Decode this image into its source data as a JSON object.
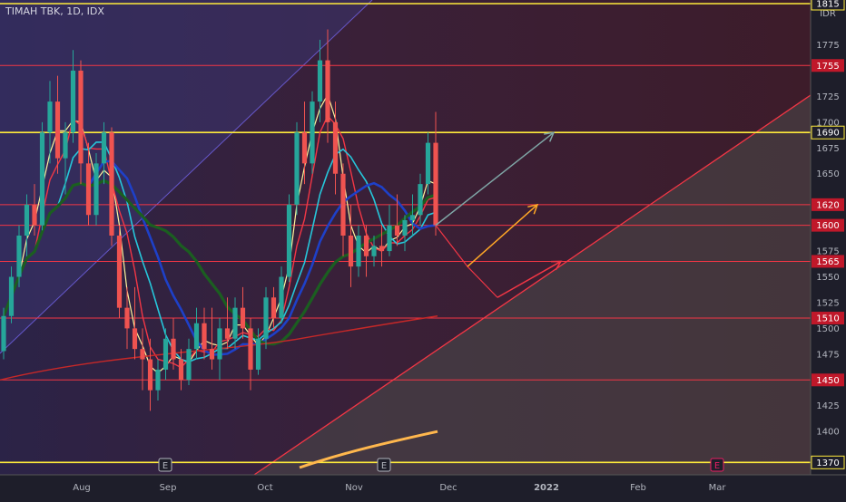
{
  "header": {
    "title": "TIMAH TBK, 1D, IDX"
  },
  "colors": {
    "bull": "#26a69a",
    "bear": "#ef5350",
    "yellow": "#ffeb3b",
    "red_line": "#f23645",
    "price_bg": "#2a1f2e"
  },
  "chart_data": {
    "type": "candlestick",
    "currency": "IDR",
    "y_ticks": [
      1775,
      1750,
      1725,
      1700,
      1675,
      1650,
      1625,
      1600,
      1575,
      1550,
      1525,
      1500,
      1475,
      1450,
      1425,
      1400
    ],
    "y_range": [
      1365,
      1815
    ],
    "x_labels": [
      "Aug",
      "Sep",
      "Oct",
      "Nov",
      "Dec",
      "2022",
      "Feb",
      "Mar"
    ],
    "levels": [
      {
        "label": "1815",
        "value": 1815,
        "color": "#ffeb3b"
      },
      {
        "label": "1755",
        "value": 1755,
        "color": "#f23645"
      },
      {
        "label": "1690",
        "value": 1690,
        "color": "#ffeb3b"
      },
      {
        "label": "1620",
        "value": 1620,
        "color": "#f23645"
      },
      {
        "label": "1600",
        "value": 1600,
        "color": "#f23645"
      },
      {
        "label": "1565",
        "value": 1565,
        "color": "#f23645"
      },
      {
        "label": "1510",
        "value": 1510,
        "color": "#f23645"
      },
      {
        "label": "1450",
        "value": 1450,
        "color": "#f23645"
      },
      {
        "label": "1370",
        "value": 1370,
        "color": "#ffeb3b"
      }
    ],
    "event_markers": [
      {
        "label": "E",
        "near": "Aug-Sep",
        "color": "#b2b5be"
      },
      {
        "label": "E",
        "near": "Nov",
        "color": "#b2b5be"
      },
      {
        "label": "E",
        "near": "Mar",
        "color": "#e91e63"
      }
    ],
    "candles": [
      {
        "o": 1478,
        "h": 1520,
        "l": 1470,
        "c": 1512
      },
      {
        "o": 1512,
        "h": 1560,
        "l": 1505,
        "c": 1550
      },
      {
        "o": 1550,
        "h": 1600,
        "l": 1540,
        "c": 1590
      },
      {
        "o": 1590,
        "h": 1630,
        "l": 1570,
        "c": 1620
      },
      {
        "o": 1620,
        "h": 1640,
        "l": 1590,
        "c": 1600
      },
      {
        "o": 1600,
        "h": 1700,
        "l": 1595,
        "c": 1690
      },
      {
        "o": 1690,
        "h": 1740,
        "l": 1660,
        "c": 1720
      },
      {
        "o": 1720,
        "h": 1745,
        "l": 1650,
        "c": 1665
      },
      {
        "o": 1665,
        "h": 1700,
        "l": 1630,
        "c": 1690
      },
      {
        "o": 1690,
        "h": 1770,
        "l": 1680,
        "c": 1750
      },
      {
        "o": 1750,
        "h": 1760,
        "l": 1640,
        "c": 1660
      },
      {
        "o": 1660,
        "h": 1680,
        "l": 1600,
        "c": 1610
      },
      {
        "o": 1610,
        "h": 1670,
        "l": 1600,
        "c": 1660
      },
      {
        "o": 1660,
        "h": 1700,
        "l": 1640,
        "c": 1690
      },
      {
        "o": 1690,
        "h": 1695,
        "l": 1580,
        "c": 1590
      },
      {
        "o": 1590,
        "h": 1600,
        "l": 1510,
        "c": 1520
      },
      {
        "o": 1520,
        "h": 1540,
        "l": 1480,
        "c": 1500
      },
      {
        "o": 1500,
        "h": 1540,
        "l": 1470,
        "c": 1480
      },
      {
        "o": 1480,
        "h": 1500,
        "l": 1440,
        "c": 1470
      },
      {
        "o": 1470,
        "h": 1490,
        "l": 1420,
        "c": 1440
      },
      {
        "o": 1440,
        "h": 1470,
        "l": 1430,
        "c": 1460
      },
      {
        "o": 1460,
        "h": 1500,
        "l": 1450,
        "c": 1490
      },
      {
        "o": 1490,
        "h": 1510,
        "l": 1460,
        "c": 1470
      },
      {
        "o": 1470,
        "h": 1480,
        "l": 1440,
        "c": 1450
      },
      {
        "o": 1450,
        "h": 1490,
        "l": 1445,
        "c": 1480
      },
      {
        "o": 1480,
        "h": 1520,
        "l": 1470,
        "c": 1505
      },
      {
        "o": 1505,
        "h": 1520,
        "l": 1470,
        "c": 1480
      },
      {
        "o": 1480,
        "h": 1520,
        "l": 1460,
        "c": 1470
      },
      {
        "o": 1470,
        "h": 1510,
        "l": 1450,
        "c": 1500
      },
      {
        "o": 1500,
        "h": 1530,
        "l": 1480,
        "c": 1490
      },
      {
        "o": 1490,
        "h": 1530,
        "l": 1480,
        "c": 1520
      },
      {
        "o": 1520,
        "h": 1540,
        "l": 1490,
        "c": 1500
      },
      {
        "o": 1500,
        "h": 1510,
        "l": 1440,
        "c": 1460
      },
      {
        "o": 1460,
        "h": 1500,
        "l": 1455,
        "c": 1490
      },
      {
        "o": 1490,
        "h": 1540,
        "l": 1480,
        "c": 1530
      },
      {
        "o": 1530,
        "h": 1540,
        "l": 1500,
        "c": 1510
      },
      {
        "o": 1510,
        "h": 1560,
        "l": 1505,
        "c": 1550
      },
      {
        "o": 1550,
        "h": 1630,
        "l": 1545,
        "c": 1620
      },
      {
        "o": 1620,
        "h": 1700,
        "l": 1610,
        "c": 1690
      },
      {
        "o": 1690,
        "h": 1720,
        "l": 1640,
        "c": 1660
      },
      {
        "o": 1660,
        "h": 1730,
        "l": 1650,
        "c": 1720
      },
      {
        "o": 1720,
        "h": 1780,
        "l": 1700,
        "c": 1760
      },
      {
        "o": 1760,
        "h": 1790,
        "l": 1680,
        "c": 1700
      },
      {
        "o": 1700,
        "h": 1720,
        "l": 1630,
        "c": 1650
      },
      {
        "o": 1650,
        "h": 1660,
        "l": 1570,
        "c": 1590
      },
      {
        "o": 1590,
        "h": 1620,
        "l": 1540,
        "c": 1560
      },
      {
        "o": 1560,
        "h": 1600,
        "l": 1550,
        "c": 1590
      },
      {
        "o": 1590,
        "h": 1600,
        "l": 1550,
        "c": 1570
      },
      {
        "o": 1570,
        "h": 1590,
        "l": 1560,
        "c": 1580
      },
      {
        "o": 1580,
        "h": 1600,
        "l": 1560,
        "c": 1575
      },
      {
        "o": 1575,
        "h": 1620,
        "l": 1570,
        "c": 1600
      },
      {
        "o": 1600,
        "h": 1630,
        "l": 1580,
        "c": 1590
      },
      {
        "o": 1590,
        "h": 1610,
        "l": 1575,
        "c": 1605
      },
      {
        "o": 1605,
        "h": 1630,
        "l": 1590,
        "c": 1610
      },
      {
        "o": 1610,
        "h": 1650,
        "l": 1600,
        "c": 1640
      },
      {
        "o": 1640,
        "h": 1690,
        "l": 1630,
        "c": 1680
      },
      {
        "o": 1680,
        "h": 1710,
        "l": 1590,
        "c": 1600
      }
    ],
    "projection_arrows": [
      {
        "from": [
          1600,
          "last"
        ],
        "to": [
          1690,
          "Dec+"
        ],
        "color": "#7fa6a6"
      },
      {
        "from": [
          1565,
          "Dec"
        ],
        "to": [
          1620,
          "2022-"
        ],
        "color": "#ffa726"
      },
      {
        "from": [
          1530,
          "Dec"
        ],
        "to": [
          1565,
          "2022"
        ],
        "color": "#f23645"
      }
    ]
  }
}
